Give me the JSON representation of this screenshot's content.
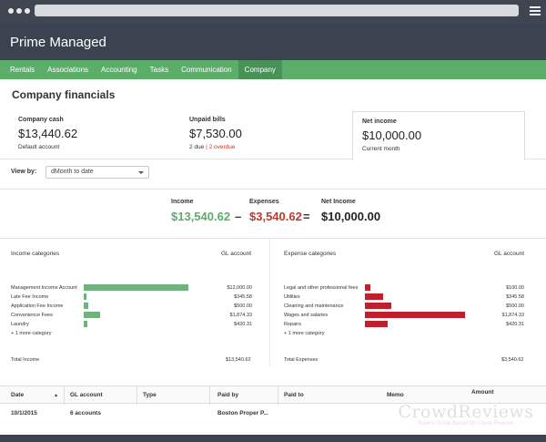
{
  "app": {
    "title": "Prime Managed"
  },
  "nav": {
    "tabs": [
      "Rentals",
      "Associations",
      "Accounting",
      "Tasks",
      "Communication",
      "Company"
    ],
    "active": "Company"
  },
  "page": {
    "title": "Company financials"
  },
  "summary": {
    "cash": {
      "label": "Company cash",
      "value": "$13,440.62",
      "sub": "Default account"
    },
    "unpaid": {
      "label": "Unpaid bills",
      "value": "$7,530.00",
      "due": "2 due",
      "sep": "|",
      "overdue": "2 overdue"
    },
    "net": {
      "label": "Net income",
      "value": "$10,000.00",
      "sub": "Current month"
    }
  },
  "filter": {
    "label": "View by:",
    "value": "dMonth to date"
  },
  "equation": {
    "income_label": "Income",
    "income_value": "$13,540.62",
    "minus": "–",
    "expenses_label": "Expenses",
    "expenses_value": "$3,540.62",
    "equals": "=",
    "net_label": "Net Income",
    "net_value": "$10,000.00"
  },
  "income": {
    "header": "Income categories",
    "gl_header": "GL account",
    "rows": [
      {
        "name": "Management Income Account",
        "amount": "$12,000.00",
        "value": 12000
      },
      {
        "name": "Late Fee Income",
        "amount": "$345.58",
        "value": 345.58
      },
      {
        "name": "Application Fee Income",
        "amount": "$500.00",
        "value": 500
      },
      {
        "name": "Convenience Fees",
        "amount": "$1,874.33",
        "value": 1874.33
      },
      {
        "name": "Laundry",
        "amount": "$420.31",
        "value": 420.31
      }
    ],
    "more": "+ 1 more category",
    "total_label": "Total Income",
    "total_value": "$13,540.62",
    "color": "#6fb27b"
  },
  "expenses": {
    "header": "Expense categories",
    "gl_header": "GL account",
    "rows": [
      {
        "name": "Legal and other professional fees",
        "amount": "$100.00",
        "value": 100
      },
      {
        "name": "Utilities",
        "amount": "$345.58",
        "value": 345.58
      },
      {
        "name": "Cleaning and maintenance",
        "amount": "$500.00",
        "value": 500
      },
      {
        "name": "Wages and salaries",
        "amount": "$1,874.33",
        "value": 1874.33
      },
      {
        "name": "Repairs",
        "amount": "$420.31",
        "value": 420.31
      }
    ],
    "more": "+ 1 more category",
    "total_label": "Total Expenses",
    "total_value": "$3,540.62",
    "color": "#c0202e"
  },
  "table": {
    "columns": [
      "Date",
      "GL account",
      "Type",
      "Paid by",
      "Paid to",
      "Memo",
      "Amount"
    ],
    "sort_indicator": "▲",
    "rows": [
      {
        "date": "10/1/2015",
        "gl": "6 accounts",
        "type": "",
        "paid_by": "Boston Proper P...",
        "paid_to": "",
        "memo": "",
        "amount": ""
      }
    ]
  },
  "watermark": {
    "main": "CrowdReviews",
    "sub": "Buyers Guide Based On Client Reviews"
  }
}
